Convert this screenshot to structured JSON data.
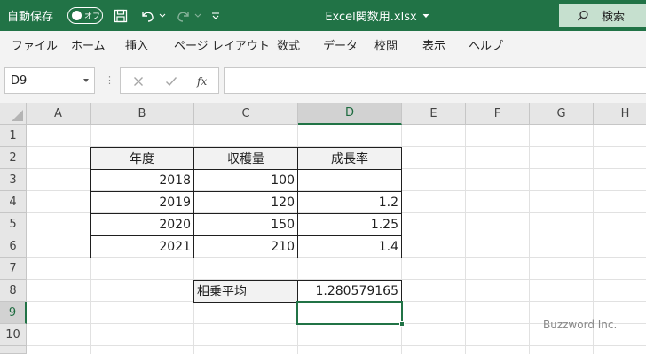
{
  "titlebar": {
    "autosave_label": "自動保存",
    "autosave_state": "オフ",
    "doc_title": "Excel関数用.xlsx",
    "search_label": "検索"
  },
  "menu": [
    "ファイル",
    "ホーム",
    "挿入",
    "ページ レイアウト",
    "数式",
    "データ",
    "校閲",
    "表示",
    "ヘルプ"
  ],
  "formula_bar": {
    "name_box": "D9",
    "fx_label": "fx",
    "content": ""
  },
  "columns": [
    "A",
    "B",
    "C",
    "D",
    "E",
    "F",
    "G",
    "H"
  ],
  "rows": [
    "1",
    "2",
    "3",
    "4",
    "5",
    "6",
    "7",
    "8",
    "9",
    "10"
  ],
  "selected_cell": "D9",
  "table": {
    "headers": [
      "年度",
      "収穫量",
      "成長率"
    ],
    "rows": [
      [
        "2018",
        "100",
        ""
      ],
      [
        "2019",
        "120",
        "1.2"
      ],
      [
        "2020",
        "150",
        "1.25"
      ],
      [
        "2021",
        "210",
        "1.4"
      ]
    ]
  },
  "result": {
    "label": "相乗平均",
    "value": "1.280579165"
  },
  "watermark": "Buzzword Inc.",
  "colors": {
    "accent": "#217346",
    "header_fill": "#f2f2f2"
  }
}
